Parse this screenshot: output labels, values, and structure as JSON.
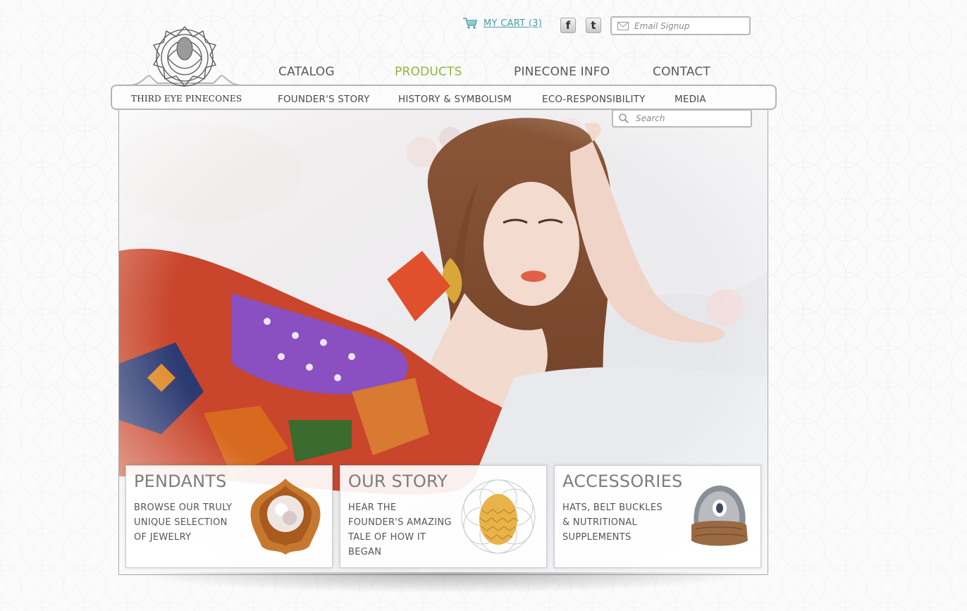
{
  "header": {
    "cart_label": "MY CART (3)",
    "email_placeholder": "Email Signup",
    "search_placeholder": "Search",
    "logo_text": "THIRD EYE PINECONES"
  },
  "nav": {
    "main": [
      "CATALOG",
      "PRODUCTS",
      "PINECONE INFO",
      "CONTACT"
    ],
    "active": "PRODUCTS",
    "sub": [
      "FOUNDER'S STORY",
      "HISTORY & SYMBOLISM",
      "ECO-RESPONSIBILITY",
      "MEDIA"
    ]
  },
  "social": {
    "facebook": "f",
    "twitter": "t"
  },
  "cards": [
    {
      "title": "PENDANTS",
      "text": "BROWSE OUR TRULY UNIQUE SELECTION OF JEWELRY"
    },
    {
      "title": "OUR STORY",
      "text": "HEAR THE FOUNDER'S AMAZING TALE OF HOW IT BEGAN"
    },
    {
      "title": "ACCESSORIES",
      "text": "HATS, BELT BUCKLES & NUTRITIONAL SUPPLEMENTS"
    }
  ],
  "colors": {
    "accent_green": "#8fb63d",
    "cart_teal": "#4a9aa8",
    "nav_text": "#5a5a5a"
  },
  "icons": [
    "cart-icon",
    "facebook-icon",
    "twitter-icon",
    "envelope-icon",
    "search-icon"
  ]
}
